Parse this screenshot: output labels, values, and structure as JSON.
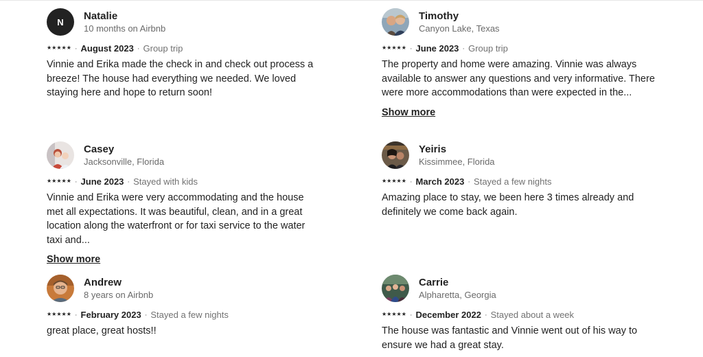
{
  "reviews": [
    {
      "name": "Natalie",
      "subtitle": "10 months on Airbnb",
      "avatar": {
        "type": "initial",
        "initial": "N",
        "icon": "user-initial-avatar"
      },
      "stars": "★★★★★",
      "date": "August 2023",
      "trip": "Group trip",
      "text": "Vinnie and Erika made the check in and check out process a breeze! The house had everything we needed. We loved staying here and hope to return soon!",
      "show_more": ""
    },
    {
      "name": "Timothy",
      "subtitle": "Canyon Lake, Texas",
      "avatar": {
        "type": "photo",
        "icon": "profile-photo"
      },
      "stars": "★★★★★",
      "date": "June 2023",
      "trip": "Group trip",
      "text": "The property and home were amazing. Vinnie was always available to answer any questions and very informative. There were more accommodations than were expected in the...",
      "show_more": "Show more"
    },
    {
      "name": "Casey",
      "subtitle": "Jacksonville, Florida",
      "avatar": {
        "type": "photo",
        "icon": "profile-photo"
      },
      "stars": "★★★★★",
      "date": "June 2023",
      "trip": "Stayed with kids",
      "text": "Vinnie and Erika were very accommodating and the house met all expectations. It was beautiful, clean, and in a great location along the waterfront or for taxi service to the water taxi and...",
      "show_more": "Show more"
    },
    {
      "name": "Yeiris",
      "subtitle": "Kissimmee, Florida",
      "avatar": {
        "type": "photo",
        "icon": "profile-photo"
      },
      "stars": "★★★★★",
      "date": "March 2023",
      "trip": "Stayed a few nights",
      "text": "Amazing place to stay, we been here 3 times already and definitely we come back again.",
      "show_more": ""
    },
    {
      "name": "Andrew",
      "subtitle": "8 years on Airbnb",
      "avatar": {
        "type": "photo",
        "icon": "profile-photo"
      },
      "stars": "★★★★★",
      "date": "February 2023",
      "trip": "Stayed a few nights",
      "text": "great place, great hosts!!",
      "show_more": ""
    },
    {
      "name": "Carrie",
      "subtitle": "Alpharetta, Georgia",
      "avatar": {
        "type": "photo",
        "icon": "profile-photo"
      },
      "stars": "★★★★★",
      "date": "December 2022",
      "trip": "Stayed about a week",
      "text": "The house was fantastic and Vinnie went out of his way to ensure we had a great stay.",
      "show_more": ""
    }
  ]
}
